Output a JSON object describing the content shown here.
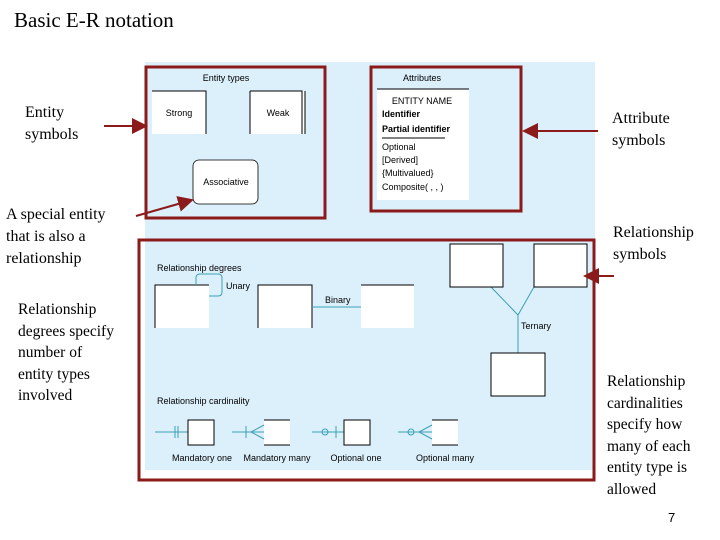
{
  "title": "Basic E-R notation",
  "page_number": "7",
  "annotations": {
    "entity_symbols": "Entity\nsymbols",
    "special_entity": "A special entity\nthat is also a\nrelationship",
    "degrees": "Relationship\ndegrees specify\nnumber of\nentity types\ninvolved",
    "attribute_symbols": "Attribute\nsymbols",
    "relationship_symbols": "Relationship\nsymbols",
    "cardinalities": "Relationship\ncardinalities\nspecify how\nmany of each\nentity type is\nallowed"
  },
  "figure": {
    "entity_types_title": "Entity types",
    "strong": "Strong",
    "weak": "Weak",
    "associative": "Associative",
    "attributes_title": "Attributes",
    "entity_name": "ENTITY NAME",
    "identifier": "Identifier",
    "partial_identifier": "Partial identifier",
    "optional": "Optional",
    "derived": "[Derived]",
    "multivalued": "{Multivalued}",
    "composite": "Composite( , , )",
    "degrees_title": "Relationship degrees",
    "unary": "Unary",
    "binary": "Binary",
    "ternary": "Ternary",
    "cardinality_title": "Relationship cardinality",
    "mandatory_one": "Mandatory one",
    "mandatory_many": "Mandatory many",
    "optional_one": "Optional one",
    "optional_many": "Optional many"
  },
  "colors": {
    "panel": "#dcf0fb",
    "highlight": "#8b1a1a",
    "line": "#3aa0b5"
  }
}
